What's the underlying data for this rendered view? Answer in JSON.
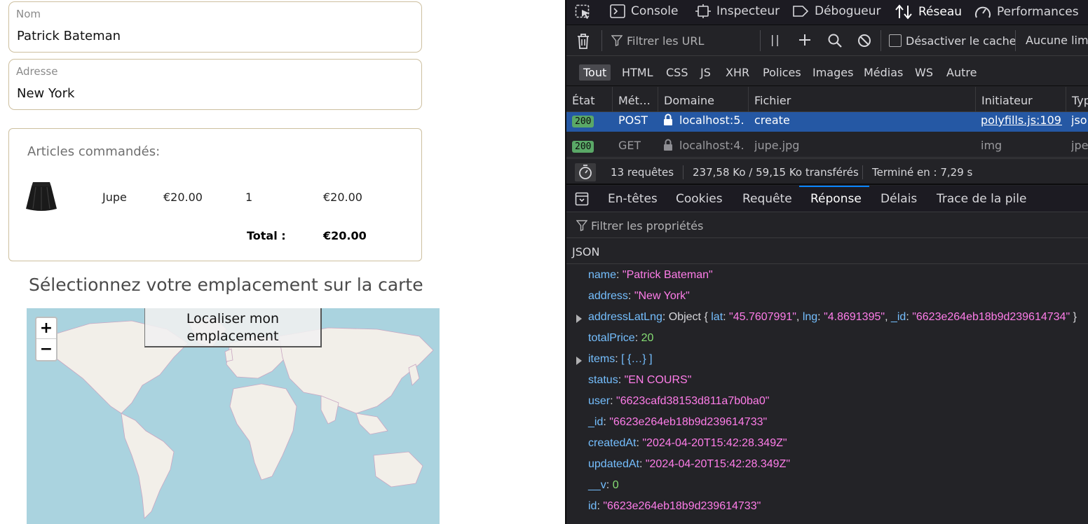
{
  "form": {
    "name": {
      "label": "Nom",
      "value": "Patrick Bateman"
    },
    "address": {
      "label": "Adresse",
      "value": "New York"
    }
  },
  "cart": {
    "title": "Articles commandés:",
    "items": [
      {
        "name": "Jupe",
        "price": "€20.00",
        "qty": "1",
        "subtotal": "€20.00",
        "image": "skirt-thumbnail"
      }
    ],
    "total_label": "Total :",
    "total_value": "€20.00"
  },
  "map": {
    "title": "Sélectionnez votre emplacement sur la carte",
    "zoom_in": "+",
    "zoom_out": "−",
    "locate_button": "Localiser mon emplacement",
    "colors": {
      "water": "#aad3df",
      "land": "#f2efe9",
      "border": "#c9a6c2"
    }
  },
  "devtools": {
    "toolbar": {
      "tabs": [
        {
          "label": "Console",
          "icon": "console-icon"
        },
        {
          "label": "Inspecteur",
          "icon": "inspector-icon"
        },
        {
          "label": "Débogueur",
          "icon": "debugger-icon"
        },
        {
          "label": "Réseau",
          "icon": "network-icon",
          "active": true
        },
        {
          "label": "Performances",
          "icon": "performance-icon"
        }
      ]
    },
    "filter": {
      "placeholder": "Filtrer les URL",
      "pause_glyph": "||",
      "disable_cache_label": "Désactiver le cache",
      "throttle_label": "Aucune limit"
    },
    "types": [
      "Tout",
      "HTML",
      "CSS",
      "JS",
      "XHR",
      "Polices",
      "Images",
      "Médias",
      "WS",
      "Autre"
    ],
    "columns": [
      "État",
      "Mét…",
      "Domaine",
      "Fichier",
      "Initiateur",
      "Typ"
    ],
    "requests": [
      {
        "status": "200",
        "method": "POST",
        "domain": "localhost:5…",
        "file": "create",
        "initiator": "polyfills.js:109…",
        "type": "json"
      },
      {
        "status": "200",
        "method": "GET",
        "domain": "localhost:4…",
        "file": "jupe.jpg",
        "initiator": "img",
        "type": "jpeg"
      }
    ],
    "summary": {
      "requests": "13 requêtes",
      "transferred": "237,58 Ko / 59,15 Ko transférés",
      "finished": "Terminé en : 7,29 s"
    },
    "panel_tabs": [
      "En-têtes",
      "Cookies",
      "Requête",
      "Réponse",
      "Délais",
      "Trace de la pile"
    ],
    "active_panel_tab": "Réponse",
    "prop_filter_placeholder": "Filtrer les propriétés",
    "json_header": "JSON",
    "response": [
      {
        "key": "name",
        "value": "\"Patrick Bateman\"",
        "kind": "string"
      },
      {
        "key": "address",
        "value": "\"New York\"",
        "kind": "string"
      },
      {
        "key": "addressLatLng",
        "kind": "object",
        "summary_prefix": "Object { ",
        "summary_fields": [
          {
            "key": "lat",
            "value": "\"45.7607991\""
          },
          {
            "key": "lng",
            "value": "\"4.8691395\""
          },
          {
            "key": "_id",
            "value": "\"6623e264eb18b9d239614734\""
          }
        ],
        "summary_suffix": " }"
      },
      {
        "key": "totalPrice",
        "value": "20",
        "kind": "number"
      },
      {
        "key": "items",
        "value": "[ {…} ]",
        "kind": "array"
      },
      {
        "key": "status",
        "value": "\"EN COURS\"",
        "kind": "string"
      },
      {
        "key": "user",
        "value": "\"6623cafd38153d811a7b0ba0\"",
        "kind": "string"
      },
      {
        "key": "_id",
        "value": "\"6623e264eb18b9d239614733\"",
        "kind": "string"
      },
      {
        "key": "createdAt",
        "value": "\"2024-04-20T15:42:28.349Z\"",
        "kind": "string"
      },
      {
        "key": "updatedAt",
        "value": "\"2024-04-20T15:42:28.349Z\"",
        "kind": "string"
      },
      {
        "key": "__v",
        "value": "0",
        "kind": "number"
      },
      {
        "key": "id",
        "value": "\"6623e264eb18b9d239614733\"",
        "kind": "string"
      }
    ]
  }
}
